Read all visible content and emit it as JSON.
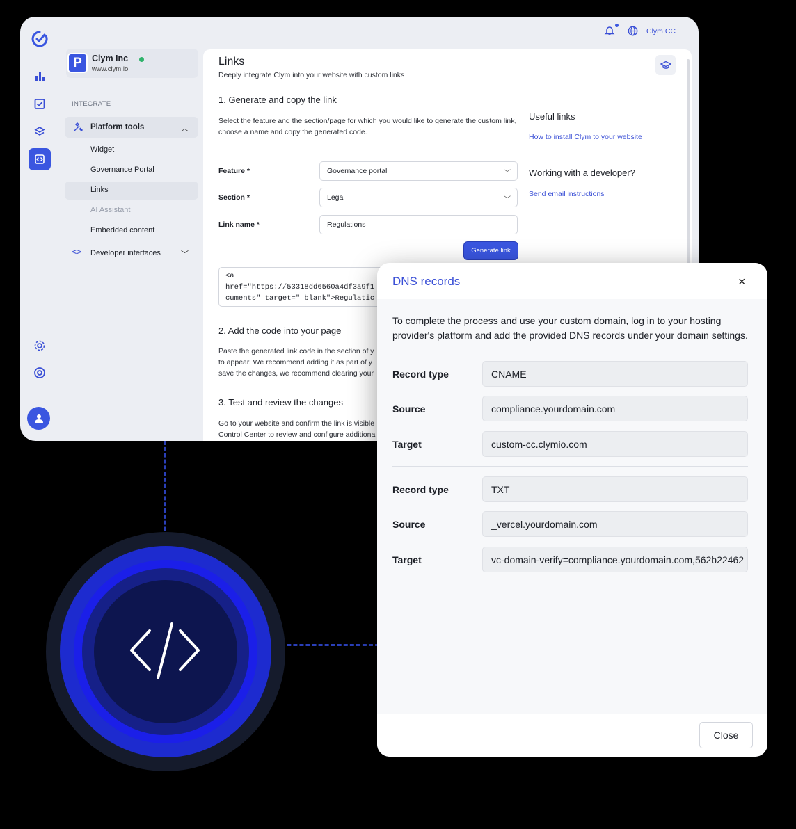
{
  "app": {
    "org": {
      "initial": "P",
      "name": "Clym Inc",
      "url": "www.clym.io"
    },
    "user": "Clym CC",
    "sidebar": {
      "section": "INTEGRATE",
      "group": "Platform tools",
      "items": [
        "Widget",
        "Governance Portal",
        "Links",
        "AI Assistant",
        "Embedded content"
      ],
      "selected": "Links",
      "developer": "Developer interfaces"
    },
    "page": {
      "title": "Links",
      "subtitle": "Deeply integrate Clym into your website with custom links",
      "step1": {
        "heading": "1. Generate and copy the link",
        "desc": "Select the feature and the section/page for which you would like to generate the custom link, choose a name and copy the generated code.",
        "feature_label": "Feature *",
        "feature_value": "Governance portal",
        "section_label": "Section *",
        "section_value": "Legal",
        "linkname_label": "Link name *",
        "linkname_value": "Regulations",
        "generate_label": "Generate link",
        "code": "<a\nhref=\"https://53318dd6560a4df3a9f1\ncuments\" target=\"_blank\">Regulatic"
      },
      "step2": {
        "heading": "2. Add the code into your page",
        "desc": "Paste the generated link code in the section of y\nto appear. We recommend adding it as part of y\nsave the changes, we recommend clearing your"
      },
      "step3": {
        "heading": "3. Test and review the changes",
        "desc": "Go to your website and confirm the link is visible\nControl Center to review and configure additiona"
      },
      "useful": {
        "heading": "Useful links",
        "link1": "How to install Clym to your website",
        "dev_heading": "Working with a developer?",
        "link2": "Send email instructions"
      }
    }
  },
  "modal": {
    "title": "DNS records",
    "close_icon": "×",
    "description": "To complete the process and use your custom domain, log in to your hosting provider's platform and add the provided DNS records under your domain settings.",
    "records": [
      {
        "type_label": "Record type",
        "type": "CNAME",
        "source_label": "Source",
        "source": "compliance.yourdomain.com",
        "target_label": "Target",
        "target": "custom-cc.clymio.com"
      },
      {
        "type_label": "Record type",
        "type": "TXT",
        "source_label": "Source",
        "source": "_vercel.yourdomain.com",
        "target_label": "Target",
        "target": "vc-domain-verify=compliance.yourdomain.com,562b22462"
      }
    ],
    "close_label": "Close"
  },
  "colors": {
    "accent": "#3a56e0",
    "background": "#000000",
    "panel": "#eceef3"
  }
}
